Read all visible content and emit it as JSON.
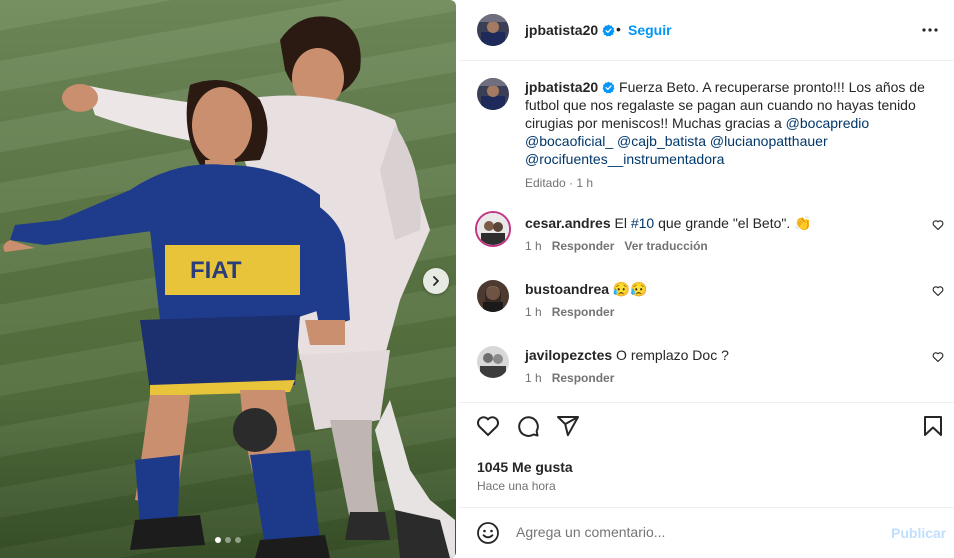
{
  "post": {
    "username": "jpbatista20",
    "follow_label": "Seguir",
    "separator": "•",
    "caption": {
      "username": "jpbatista20",
      "text_1": " Fuerza Beto. A recuperarse pronto!!! Los años de futbol que nos regalaste se pagan aun cuando no hayas tenido cirugias por meniscos!! Muchas gracias a ",
      "mention_1": "@bocapredio",
      "mention_2": "@bocaoficial_",
      "mention_3": "@cajb_batista",
      "mention_4": "@lucianopatthauer",
      "mention_5": "@rocifuentes__instrumentadora",
      "meta": "Editado · 1 h"
    },
    "comments": [
      {
        "username": "cesar.andres",
        "text_before": " El ",
        "hashtag": "#10",
        "text_after": " que grande \"el Beto\". 👏",
        "time": "1 h",
        "reply": "Responder",
        "translate": "Ver traducción"
      },
      {
        "username": "bustoandrea",
        "text": " 😥😥",
        "time": "1 h",
        "reply": "Responder"
      },
      {
        "username": "javilopezctes",
        "text": " O remplazo Doc ?",
        "time": "1 h",
        "reply": "Responder"
      }
    ],
    "likes": "1045 Me gusta",
    "time_ago": "Hace una hora",
    "comment_placeholder": "Agrega un comentario...",
    "post_label": "Publicar"
  },
  "carousel": {
    "slide_count": 3,
    "active_slide": 1
  },
  "colors": {
    "accent": "#0095f6",
    "link": "#00376b",
    "muted": "#737373",
    "post_disabled": "#c0dffd"
  },
  "icons": [
    "verified-icon",
    "more-options-icon",
    "heart-icon",
    "comment-icon",
    "share-icon",
    "bookmark-icon",
    "emoji-icon",
    "chevron-right-icon"
  ]
}
